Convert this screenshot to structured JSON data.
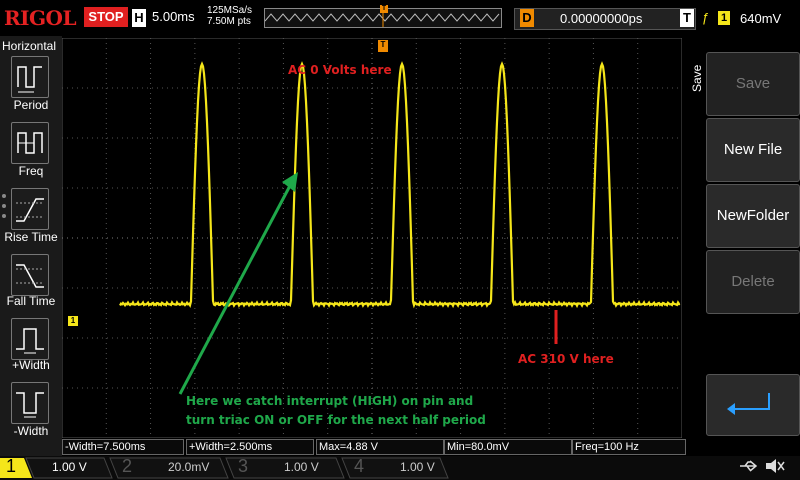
{
  "top": {
    "brand": "RIGOL",
    "run_state": "STOP",
    "timebase_badge": "H",
    "timebase": "5.00ms",
    "sample_rate": "125MSa/s",
    "memory_depth": "7.50M pts",
    "trigger_marker": "T",
    "delay_badge": "D",
    "delay_value": "0.00000000ps",
    "trigger_badge": "T",
    "trigger_edge": "ƒ",
    "trigger_source": "1",
    "trigger_level": "640mV"
  },
  "left_panel": {
    "title": "Horizontal",
    "items": [
      {
        "label": "Period",
        "icon": "period-icon"
      },
      {
        "label": "Freq",
        "icon": "freq-icon"
      },
      {
        "label": "Rise Time",
        "icon": "rise-time-icon"
      },
      {
        "label": "Fall Time",
        "icon": "fall-time-icon"
      },
      {
        "label": "+Width",
        "icon": "positive-width-icon"
      },
      {
        "label": "-Width",
        "icon": "negative-width-icon"
      }
    ]
  },
  "right_panel": {
    "title": "Save",
    "buttons": [
      {
        "label": "Save",
        "enabled": false
      },
      {
        "label": "New File",
        "enabled": true
      },
      {
        "label": "NewFolder",
        "enabled": true
      },
      {
        "label": "Delete",
        "enabled": false
      },
      {
        "label": "",
        "icon": "return-arrow-icon",
        "enabled": true
      }
    ]
  },
  "annotations": {
    "zero_volts": "AC 0 Volts here",
    "peak_volts": "AC 310 V here",
    "interrupt_line1": "Here we catch interrupt (HIGH) on pin and",
    "interrupt_line2": "turn triac ON or OFF for the next half period"
  },
  "measurements": [
    "-Width=7.500ms",
    "+Width=2.500ms",
    "Max=4.88 V",
    "Min=80.0mV",
    "Freq=100 Hz"
  ],
  "markers": {
    "ch1_ground": "1",
    "trigger_level_marker": "T",
    "trigger_position_marker": "T"
  },
  "channels": [
    {
      "num": "1",
      "scale": "1.00 V",
      "color": "#f5e61a",
      "active": true
    },
    {
      "num": "2",
      "scale": "20.0mV",
      "color": "#22c4e0",
      "active": false
    },
    {
      "num": "3",
      "scale": "1.00 V",
      "color": "#e022c8",
      "active": false
    },
    {
      "num": "4",
      "scale": "1.00 V",
      "color": "#2a5cff",
      "active": false
    }
  ],
  "status_icons": [
    "usb-icon",
    "speaker-muted-icon"
  ],
  "colors": {
    "ch1": "#f5e61a",
    "annotation_red": "#e02020",
    "annotation_green": "#1fa84a",
    "trigger_orange": "#f08a00",
    "stop_red": "#e02020"
  },
  "signal": {
    "period_ms": 10,
    "high_width_ms": 2.5,
    "low_width_ms": 7.5,
    "max_v": 4.88,
    "min_v": 0.08
  }
}
